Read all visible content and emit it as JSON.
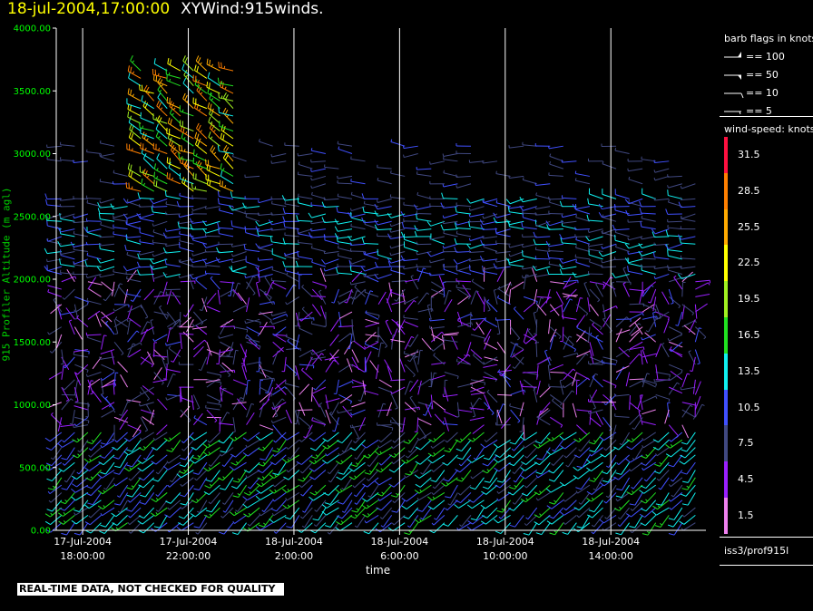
{
  "header": {
    "datetime": "18-jul-2004,17:00:00",
    "description": "XYWind:915winds."
  },
  "warning": "REAL-TIME DATA, NOT CHECKED FOR QUALITY",
  "station": "iss3/prof915l",
  "colors": {
    "background": "#000000",
    "axis_text": "#00ff00",
    "title_time": "#ffff00",
    "gridlines": "#ffffff"
  },
  "chart_data": {
    "type": "wind-barb",
    "ylabel": "915 Profiler Altitude (m agl)",
    "xlabel": "time",
    "ylim": [
      0,
      4000
    ],
    "y_ticks": [
      "0.00",
      "500.00",
      "1000.00",
      "1500.00",
      "2000.00",
      "2500.00",
      "3000.00",
      "3500.00",
      "4000.00"
    ],
    "x_range_hours": [
      -1,
      23.6
    ],
    "x_ticks": [
      {
        "date": "17-Jul-2004",
        "time": "18:00:00"
      },
      {
        "date": "17-Jul-2004",
        "time": "22:00:00"
      },
      {
        "date": "18-Jul-2004",
        "time": "2:00:00"
      },
      {
        "date": "18-Jul-2004",
        "time": "6:00:00"
      },
      {
        "date": "18-Jul-2004",
        "time": "10:00:00"
      },
      {
        "date": "18-Jul-2004",
        "time": "14:00:00"
      }
    ],
    "grid": "vertical lines at time ticks",
    "barb_legend": {
      "title": "barb flags in knots",
      "entries": [
        "== 100",
        "== 50",
        "== 10",
        "== 5"
      ]
    },
    "speed_legend": {
      "title": "wind-speed: knots",
      "bins": [
        {
          "label": "31.5",
          "color": "#ff1040"
        },
        {
          "label": "28.5",
          "color": "#ff7f00"
        },
        {
          "label": "25.5",
          "color": "#ffaa00"
        },
        {
          "label": "22.5",
          "color": "#ffff00"
        },
        {
          "label": "19.5",
          "color": "#a0f020"
        },
        {
          "label": "16.5",
          "color": "#20e020"
        },
        {
          "label": "13.5",
          "color": "#10f0f0"
        },
        {
          "label": "10.5",
          "color": "#4050ff"
        },
        {
          "label": "7.5",
          "color": "#404880"
        },
        {
          "label": "4.5",
          "color": "#9a20ff"
        },
        {
          "label": "1.5",
          "color": "#ee80ee"
        }
      ]
    },
    "barb_summary": {
      "time_columns_every_minutes": 30,
      "altitude_spacing_m": 60,
      "regions": [
        {
          "altitude_m": [
            0,
            800
          ],
          "speed_knots_range": [
            7,
            17
          ],
          "direction": "southwesterly"
        },
        {
          "altitude_m": [
            800,
            2000
          ],
          "speed_knots_range": [
            2,
            10
          ],
          "direction": "variable"
        },
        {
          "altitude_m": [
            2000,
            2700
          ],
          "speed_knots_range": [
            6,
            14
          ],
          "direction": "westerly"
        },
        {
          "altitude_m": [
            2700,
            3700
          ],
          "speed_knots_range": [
            12,
            30
          ],
          "direction": "northwesterly",
          "time_window_hours": [
            2,
            6
          ]
        }
      ]
    }
  }
}
